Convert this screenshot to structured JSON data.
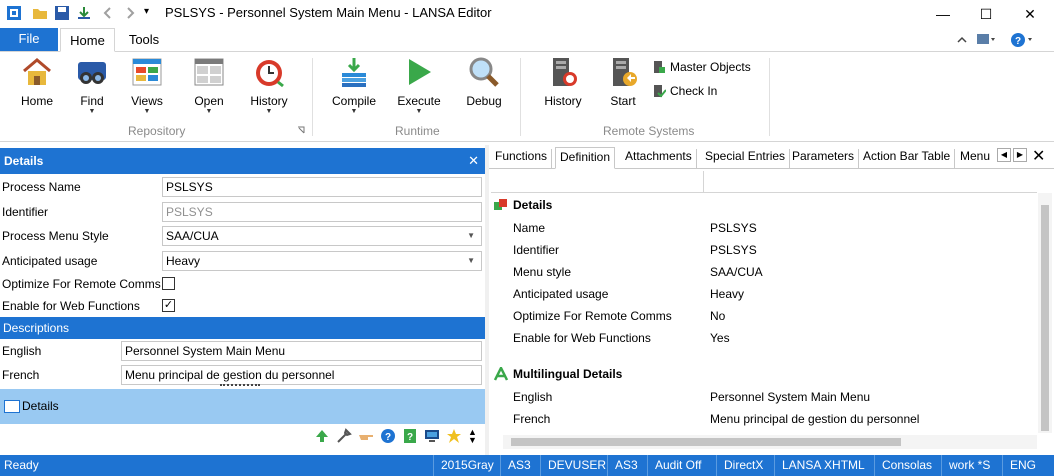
{
  "window": {
    "title": "PSLSYS - Personnel System Main Menu - LANSA Editor",
    "minimize": "—",
    "maximize": "☐",
    "close": "✕",
    "qat_more": "▾"
  },
  "ribbon_tabs": {
    "file": "File",
    "home": "Home",
    "tools": "Tools"
  },
  "ribbon": {
    "groups": {
      "repository": "Repository",
      "runtime": "Runtime",
      "remote": "Remote Systems"
    },
    "buttons": {
      "home": "Home",
      "find": "Find",
      "views": "Views",
      "open": "Open",
      "history": "History",
      "compile": "Compile",
      "execute": "Execute",
      "debug": "Debug",
      "remote_history": "History",
      "start": "Start",
      "master_objects": "Master Objects",
      "check_in": "Check In"
    }
  },
  "left": {
    "header": "Details",
    "close": "✕",
    "fields": {
      "process_name_label": "Process Name",
      "process_name_value": "PSLSYS",
      "identifier_label": "Identifier",
      "identifier_value": "PSLSYS",
      "menu_style_label": "Process Menu Style",
      "menu_style_value": "SAA/CUA",
      "usage_label": "Anticipated usage",
      "usage_value": "Heavy",
      "optimize_label": "Optimize For Remote Comms",
      "web_label": "Enable for Web Functions",
      "web_checked": "✓"
    },
    "descriptions_header": "Descriptions",
    "english_label": "English",
    "english_value": "Personnel System Main Menu",
    "french_label": "French",
    "french_value": "Menu principal de gestion du personnel",
    "details_bar": "Details"
  },
  "right": {
    "tabs": {
      "functions": "Functions",
      "definition": "Definition",
      "attachments": "Attachments",
      "special_entries": "Special Entries",
      "parameters": "Parameters",
      "action_bar_table": "Action Bar Table",
      "menu": "Menu"
    },
    "close": "✕",
    "details_section": "Details",
    "details": {
      "name_k": "Name",
      "name_v": "PSLSYS",
      "id_k": "Identifier",
      "id_v": "PSLSYS",
      "menu_k": "Menu style",
      "menu_v": "SAA/CUA",
      "usage_k": "Anticipated usage",
      "usage_v": "Heavy",
      "opt_k": "Optimize For Remote Comms",
      "opt_v": "No",
      "web_k": "Enable for Web Functions",
      "web_v": "Yes"
    },
    "multi_section": "Multilingual Details",
    "multi": {
      "en_k": "English",
      "en_v": "Personnel System Main Menu",
      "fr_k": "French",
      "fr_v": "Menu principal de gestion du personnel"
    }
  },
  "status": {
    "ready": "Ready",
    "items": [
      "2015Gray",
      "AS3",
      "DEVUSER",
      "AS3",
      "Audit Off",
      "DirectX",
      "LANSA XHTML",
      "Consolas",
      "work *S",
      "ENG"
    ]
  },
  "colors": {
    "accent": "#1e73d2",
    "details_bar": "#99c9f2"
  }
}
